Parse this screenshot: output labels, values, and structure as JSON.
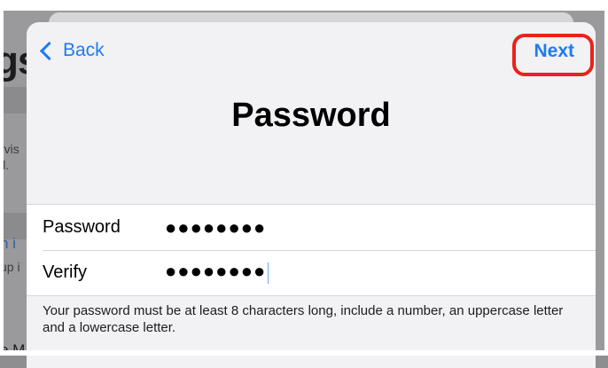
{
  "background": {
    "title_fragment": "gs",
    "text_fragments": [
      "rvis",
      "il.",
      "n i",
      "up i",
      "e M"
    ]
  },
  "nav": {
    "back_label": "Back",
    "next_label": "Next"
  },
  "title": "Password",
  "form": {
    "rows": [
      {
        "label": "Password",
        "value": "●●●●●●●●"
      },
      {
        "label": "Verify",
        "value": "●●●●●●●●"
      }
    ]
  },
  "hint": "Your password must be at least 8 characters long, include a number, an uppercase letter and a lowercase letter.",
  "colors": {
    "accent": "#1a7cf5",
    "highlight": "#e8231b"
  }
}
